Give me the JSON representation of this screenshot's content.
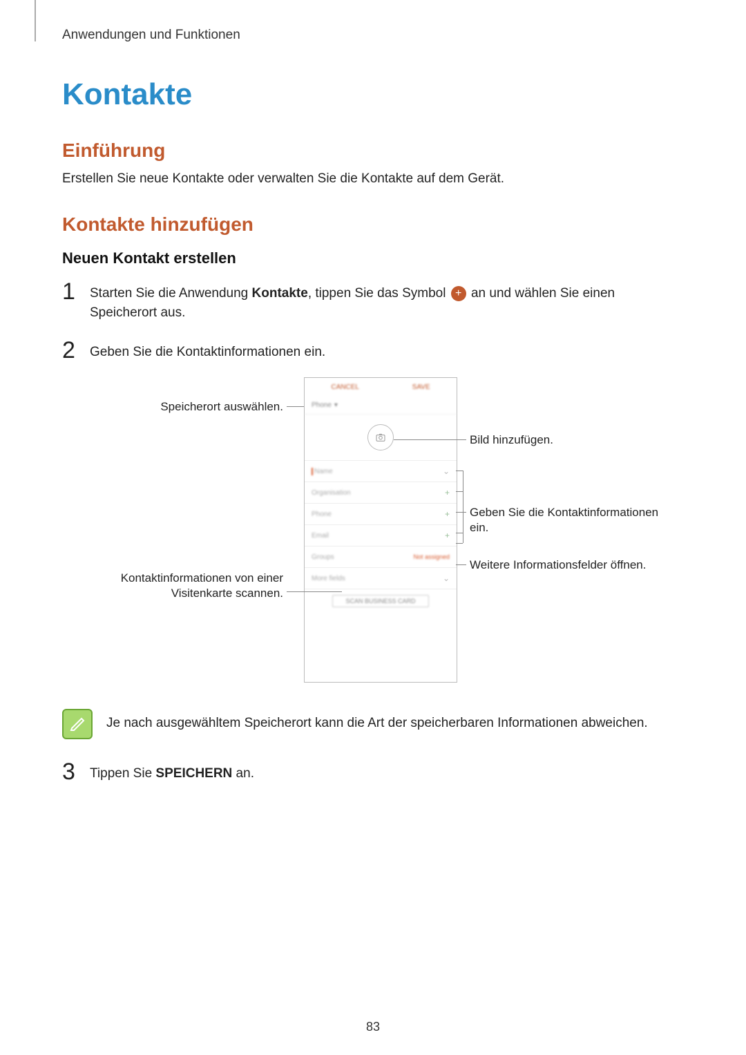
{
  "breadcrumb": "Anwendungen und Funktionen",
  "title": "Kontakte",
  "section_intro": {
    "heading": "Einführung",
    "text": "Erstellen Sie neue Kontakte oder verwalten Sie die Kontakte auf dem Gerät."
  },
  "section_add": {
    "heading": "Kontakte hinzufügen",
    "subheading": "Neuen Kontakt erstellen"
  },
  "steps": {
    "1": {
      "num": "1",
      "text_a": "Starten Sie die Anwendung ",
      "bold_a": "Kontakte",
      "text_b": ", tippen Sie das Symbol ",
      "text_c": " an und wählen Sie einen Speicherort aus."
    },
    "2": {
      "num": "2",
      "text": "Geben Sie die Kontaktinformationen ein."
    },
    "3": {
      "num": "3",
      "text_a": "Tippen Sie ",
      "bold_a": "SPEICHERN",
      "text_b": " an."
    }
  },
  "callouts": {
    "left1": "Speicherort auswählen.",
    "left2": "Kontaktinformationen von einer Visitenkarte scannen.",
    "right1": "Bild hinzufügen.",
    "right2": "Geben Sie die Kontaktinformationen ein.",
    "right3": "Weitere Informationsfelder öffnen."
  },
  "phone": {
    "top_left": "CANCEL",
    "top_right": "SAVE",
    "dropdown": "Phone",
    "fields": {
      "name": "Name",
      "org": "Organisation",
      "phone": "Phone",
      "email": "Email",
      "groups": "Groups",
      "groups_val": "Not assigned",
      "more": "More fields"
    },
    "scan": "SCAN BUSINESS CARD"
  },
  "note": "Je nach ausgewähltem Speicherort kann die Art der speicherbaren Informationen abweichen.",
  "page_num": "83"
}
